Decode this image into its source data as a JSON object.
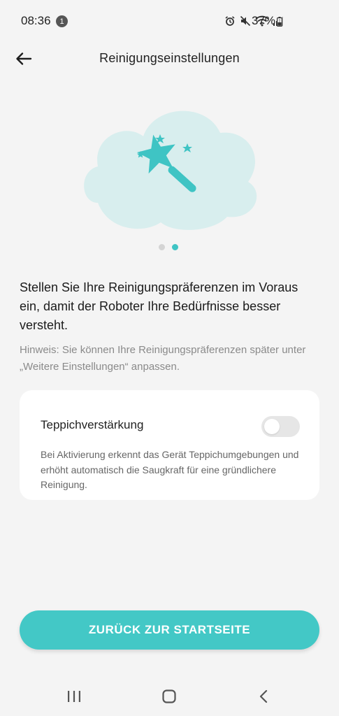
{
  "status_bar": {
    "time": "08:36",
    "notification_count": "1",
    "battery": "37%",
    "icons": [
      "alarm-icon",
      "mute-icon",
      "wifi-icon",
      "signal-icon",
      "battery-icon"
    ]
  },
  "header": {
    "title": "Reinigungseinstellungen",
    "back_icon": "back-arrow-icon"
  },
  "illustration": {
    "icon": "magic-wand-icon",
    "accent_color": "#3fc4c4",
    "cloud_color": "#d8eeee"
  },
  "pager": {
    "count": 2,
    "active_index": 1
  },
  "content": {
    "lead": "Stellen Sie Ihre Reinigungspräferenzen im Voraus ein, damit der Roboter Ihre Bedürfnisse besser versteht.",
    "hint": "Hinweis: Sie können Ihre Reinigungspräferenzen später unter „Weitere Einstellungen“ anpassen."
  },
  "setting_card": {
    "title": "Teppichverstärkung",
    "toggle_on": false,
    "description": "Bei Aktivierung erkennt das Gerät Teppichumgebungen und erhöht automatisch die Saugkraft für eine gründlichere Reinigung."
  },
  "actions": {
    "primary_label": "ZURÜCK ZUR STARTSEITE",
    "primary_color": "#43c8c6"
  },
  "nav_bar": {
    "items": [
      "recent-apps-icon",
      "home-icon",
      "back-icon"
    ]
  }
}
